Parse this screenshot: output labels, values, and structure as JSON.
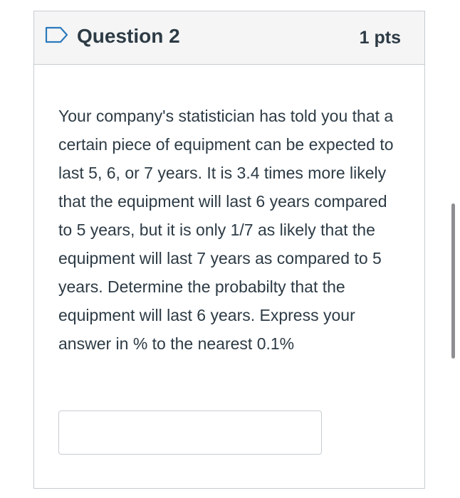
{
  "question": {
    "title": "Question 2",
    "points": "1 pts",
    "flag_icon": "flag-outline-icon",
    "body": "Your company's statistician has told you that a certain piece of equipment can be expected to last 5, 6, or 7 years. It is 3.4 times more likely that the equipment will last 6 years compared to 5 years, but it is only 1/7 as likely that the equipment will last 7 years as compared to 5 years. Determine the probabilty that the equipment will last 6 years. Express your answer in % to the nearest 0.1%",
    "answer_value": ""
  },
  "colors": {
    "text": "#2d3b45",
    "header_bg": "#f5f5f5",
    "border": "#c7cdd1",
    "flag_accent": "#2b7abc",
    "scrollbar": "#8e8e93"
  }
}
